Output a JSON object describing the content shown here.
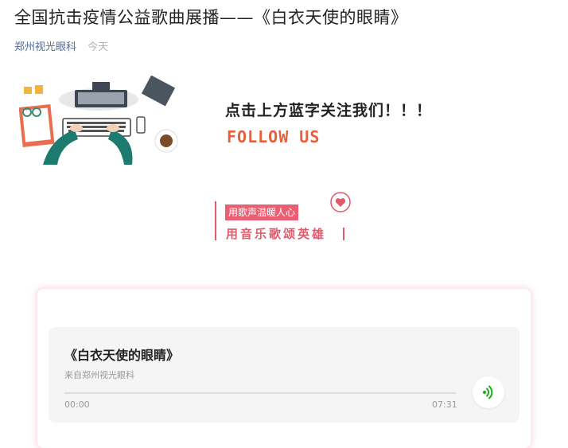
{
  "article": {
    "title": "全国抗击疫情公益歌曲展播——《白衣天使的眼睛》",
    "account": "郑州视光眼科",
    "date": "今天"
  },
  "banner": {
    "cta": "点击上方蓝字关注我们！！！",
    "follow": "FOLLOW US"
  },
  "slogan": {
    "tag": "用歌声温暖人心",
    "line": "用音乐歌颂英雄"
  },
  "player": {
    "song_title": "《白衣天使的眼睛》",
    "source": "来自郑州视光眼科",
    "time_current": "00:00",
    "time_total": "07:31",
    "progress": 0,
    "icon": "audio-wave-icon"
  },
  "colors": {
    "link": "#576b95",
    "follow": "#e5603c",
    "slogan": "#e05a6a",
    "play": "#1aad19"
  }
}
